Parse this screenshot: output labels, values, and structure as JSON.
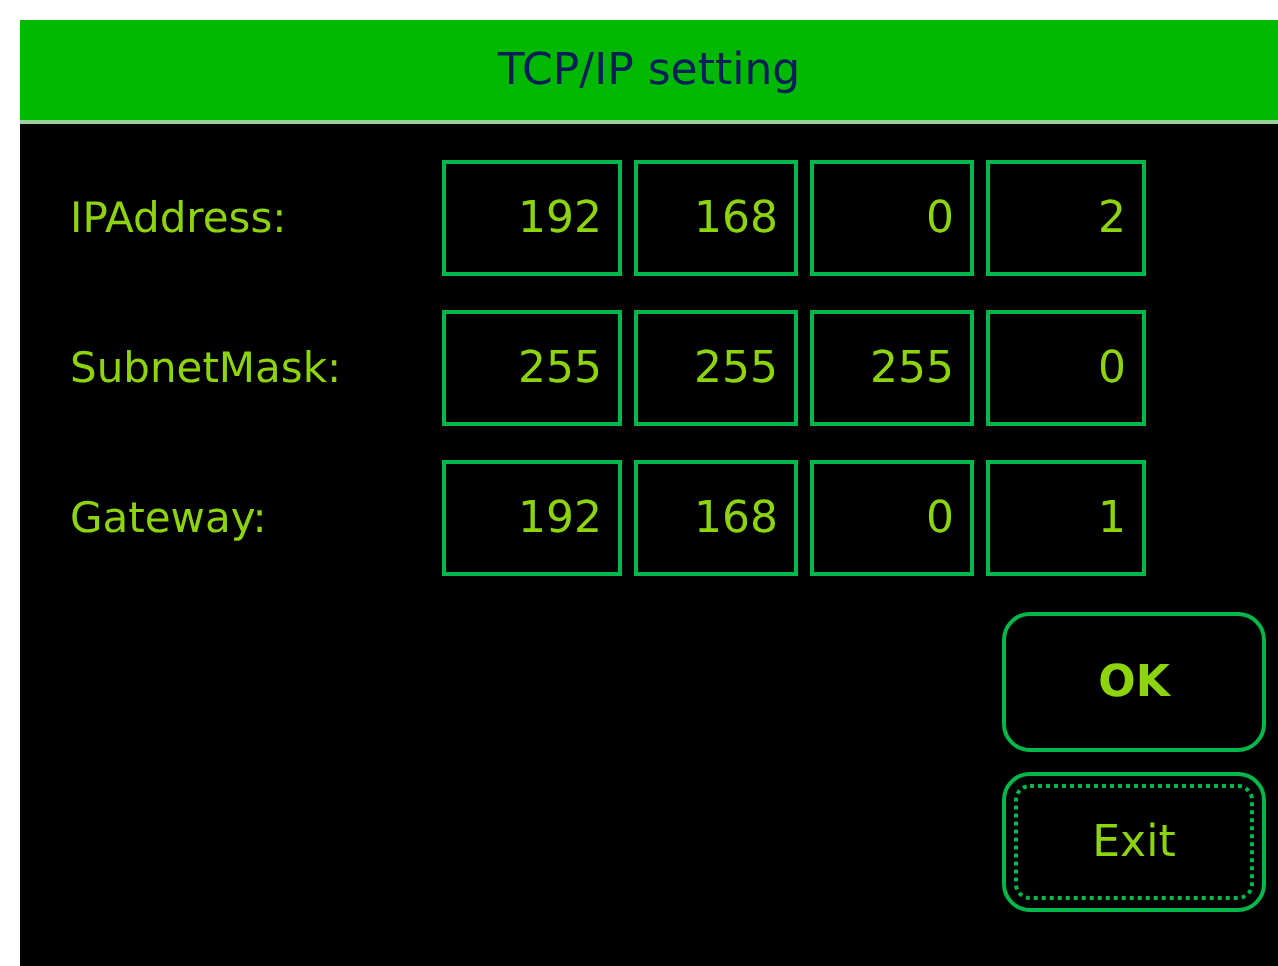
{
  "window": {
    "title": "TCP/IP setting"
  },
  "rows": [
    {
      "label": "IPAddress:",
      "octets": [
        "192",
        "168",
        "0",
        "2"
      ]
    },
    {
      "label": "SubnetMask:",
      "octets": [
        "255",
        "255",
        "255",
        "0"
      ]
    },
    {
      "label": "Gateway:",
      "octets": [
        "192",
        "168",
        "0",
        "1"
      ]
    }
  ],
  "buttons": [
    {
      "label": "OK",
      "focused": false
    },
    {
      "label": "Exit",
      "focused": true
    }
  ]
}
